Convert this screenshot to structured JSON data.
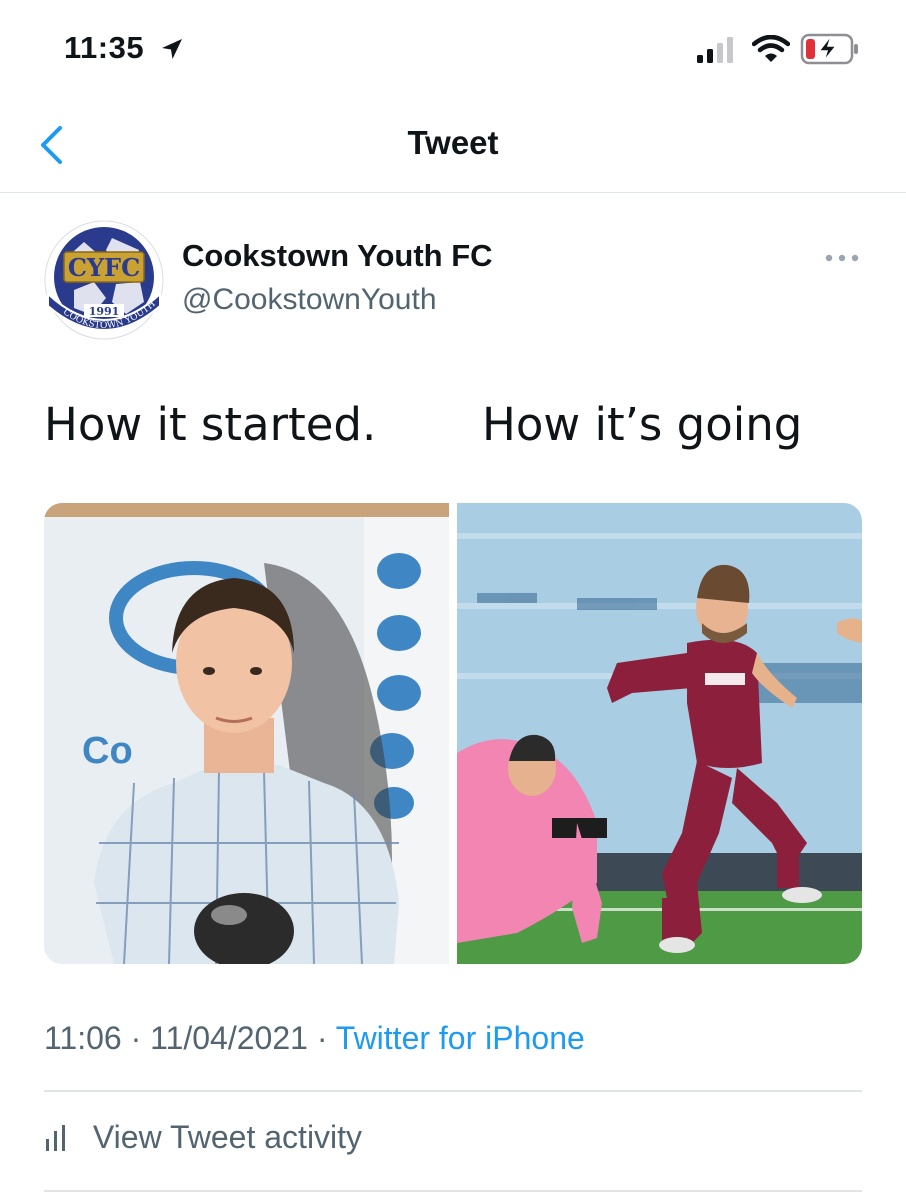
{
  "status_bar": {
    "time": "11:35",
    "icons": [
      "location-arrow-icon",
      "cellular-signal-icon",
      "wifi-icon",
      "battery-charging-icon"
    ]
  },
  "nav": {
    "title": "Tweet",
    "back_icon": "chevron-left-icon"
  },
  "tweet": {
    "author": {
      "display_name": "Cookstown Youth FC",
      "handle": "@CookstownYouth",
      "avatar": {
        "initials": "CYFC",
        "year": "1991",
        "ring_text": "COOKSTOWN YOUTH"
      }
    },
    "more_icon": "ellipsis-icon",
    "text_left": "How it started.",
    "text_right": "How it’s going",
    "media": {
      "left_photo": "boy-with-trophy-photo",
      "right_photo": "footballer-celebrating-photo"
    },
    "timestamp": "11:06 · 11/04/2021 · ",
    "source": "Twitter for iPhone",
    "activity_label": "View Tweet activity",
    "activity_icon": "bar-chart-icon"
  },
  "colors": {
    "accent": "#1d9bf0",
    "text_primary": "#0f1419",
    "text_secondary": "#536471",
    "divider": "#e1e4e8",
    "battery_red": "#e0303a"
  }
}
